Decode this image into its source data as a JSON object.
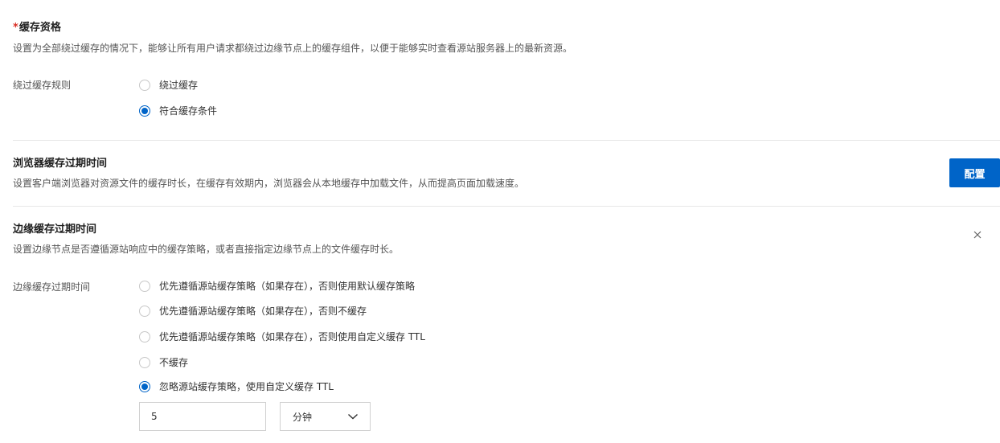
{
  "cache_eligibility": {
    "required_mark": "*",
    "title": "缓存资格",
    "description": "设置为全部绕过缓存的情况下，能够让所有用户请求都绕过边缘节点上的缓存组件，以便于能够实时查看源站服务器上的最新资源。",
    "rule_label": "绕过缓存规则",
    "options": [
      {
        "label": "绕过缓存",
        "checked": false
      },
      {
        "label": "符合缓存条件",
        "checked": true
      }
    ]
  },
  "browser_cache": {
    "title": "浏览器缓存过期时间",
    "description": "设置客户端浏览器对资源文件的缓存时长，在缓存有效期内，浏览器会从本地缓存中加载文件，从而提高页面加载速度。",
    "config_button_label": "配置"
  },
  "edge_cache": {
    "title": "边缘缓存过期时间",
    "description": "设置边缘节点是否遵循源站响应中的缓存策略，或者直接指定边缘节点上的文件缓存时长。",
    "field_label": "边缘缓存过期时间",
    "options": [
      {
        "label": "优先遵循源站缓存策略（如果存在），否则使用默认缓存策略",
        "checked": false
      },
      {
        "label": "优先遵循源站缓存策略（如果存在），否则不缓存",
        "checked": false
      },
      {
        "label": "优先遵循源站缓存策略（如果存在），否则使用自定义缓存 TTL",
        "checked": false
      },
      {
        "label": "不缓存",
        "checked": false
      },
      {
        "label": "忽略源站缓存策略，使用自定义缓存 TTL",
        "checked": true
      }
    ],
    "ttl_value": "5",
    "ttl_unit": "分钟",
    "close_icon": "close-icon"
  },
  "colors": {
    "accent": "#0064c8",
    "required": "#d93026",
    "divider": "#e6e6e6"
  }
}
